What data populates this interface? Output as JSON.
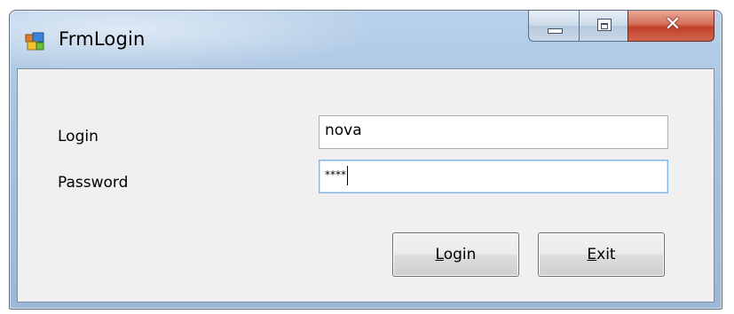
{
  "window": {
    "title": "FrmLogin",
    "icon": "winforms-app-icon",
    "caption_buttons": {
      "minimize": "minimize-icon",
      "maximize": "maximize-icon",
      "close": "close-icon"
    }
  },
  "form": {
    "login_label": "Login",
    "password_label": "Password",
    "login_value": "nova",
    "password_mask": "****"
  },
  "buttons": {
    "login": {
      "mnemonic": "L",
      "rest": "ogin"
    },
    "exit": {
      "mnemonic": "E",
      "rest": "xit"
    }
  },
  "colors": {
    "titlebar": "#a7c2de",
    "client_bg": "#f0f0f0",
    "close_button": "#c1402a",
    "focus_border": "#7eb4ea"
  }
}
